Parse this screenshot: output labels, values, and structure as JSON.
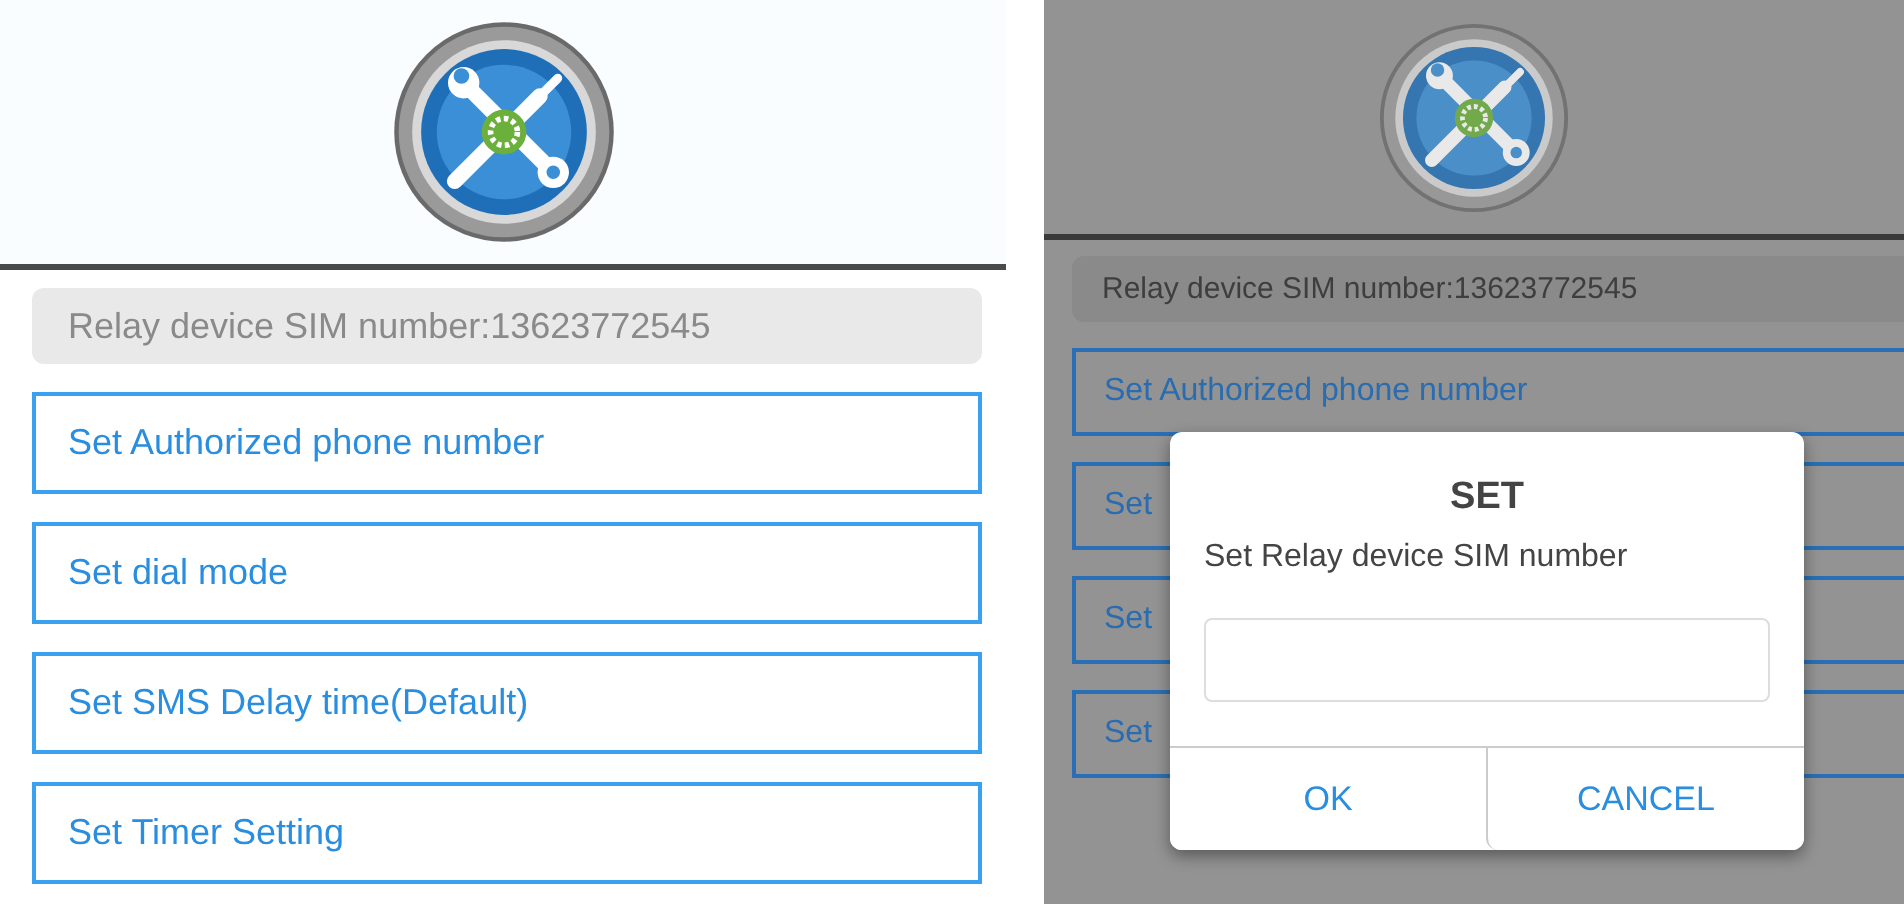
{
  "screens": [
    {
      "kind": "main",
      "sim_info": "Relay device SIM number:13623772545",
      "menu": [
        "Set Authorized phone number",
        "Set dial mode",
        "Set SMS Delay time(Default)",
        "Set Timer Setting"
      ]
    },
    {
      "kind": "dimmed",
      "sim_info": "Relay device SIM number:13623772545",
      "menu": [
        "Set Authorized phone number",
        "Set",
        "Set",
        "Set"
      ],
      "dialog": {
        "title": "SET",
        "message": "Set Relay device SIM number",
        "buttons": [
          "OK",
          "CANCEL"
        ]
      }
    }
  ]
}
